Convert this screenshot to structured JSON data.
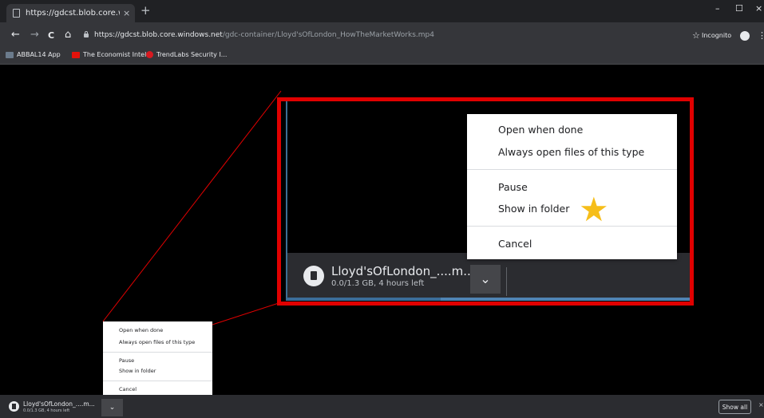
{
  "tab": {
    "title": "https://gdcst.blob.core.windows",
    "close": "×",
    "new_tab": "+"
  },
  "window": {
    "minimize": "–",
    "maximize": "☐",
    "close": "×"
  },
  "toolbar": {
    "back": "←",
    "forward": "→",
    "reload": "C",
    "home": "⌂",
    "url_host": "https://gdcst.blob.core.windows.net",
    "url_path": "/gdc-container/Lloyd'sOfLondon_HowTheMarketWorks.mp4",
    "bookmark_star": "☆",
    "incognito_label": "Incognito",
    "menu": "⋮"
  },
  "bookmarks": [
    {
      "label": "ABBAL14 App",
      "color": "#6b7b8c"
    },
    {
      "label": "The Economist Intel...",
      "color": "#e3120b"
    },
    {
      "label": "TrendLabs Security I...",
      "color": "#d71920"
    }
  ],
  "context_menu": {
    "items": [
      "Open when done",
      "Always open files of this type",
      "Pause",
      "Show in folder",
      "Cancel"
    ]
  },
  "download": {
    "filename": "Lloyd'sOfLondon_....m...",
    "status": "0.0/1.3 GB, 4 hours left",
    "chevron": "⌄"
  },
  "shelf": {
    "show_all": "Show all",
    "close": "×"
  },
  "annotation": {
    "star": "★",
    "highlight_color": "#e00000",
    "star_color": "#f6be1a"
  }
}
